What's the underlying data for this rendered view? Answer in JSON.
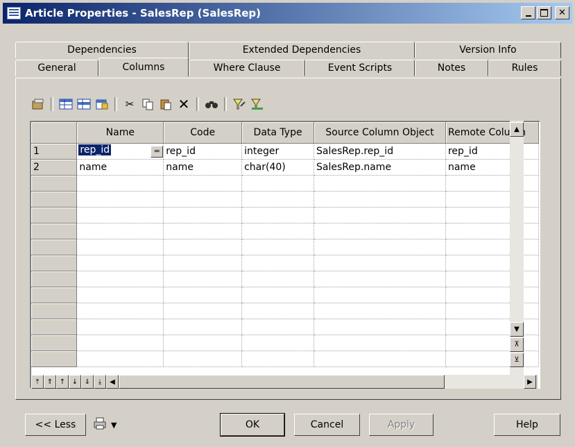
{
  "window": {
    "title": "Article Properties - SalesRep (SalesRep)"
  },
  "tabs_back": [
    "Dependencies",
    "Extended Dependencies",
    "Version Info"
  ],
  "tabs_front": [
    "General",
    "Columns",
    "Where Clause",
    "Event Scripts",
    "Notes",
    "Rules"
  ],
  "active_tab": "Columns",
  "toolbar": {
    "icons": [
      "properties-icon",
      "add-row-icon",
      "insert-row-icon",
      "add-columns-icon",
      "cut-icon",
      "copy-icon",
      "paste-icon",
      "delete-icon",
      "find-icon",
      "filter-icon",
      "clear-filter-icon"
    ]
  },
  "grid": {
    "columns": [
      "Name",
      "Code",
      "Data Type",
      "Source Column Object",
      "Remote Column"
    ],
    "rows": [
      {
        "num": "1",
        "name": "rep_id",
        "code": "rep_id",
        "type": "integer",
        "source": "SalesRep.rep_id",
        "remote": "rep_id"
      },
      {
        "num": "2",
        "name": "name",
        "code": "name",
        "type": "char(40)",
        "source": "SalesRep.name",
        "remote": "name"
      }
    ],
    "ellipsis": "="
  },
  "buttons": {
    "less": "<< Less",
    "ok": "OK",
    "cancel": "Cancel",
    "apply": "Apply",
    "help": "Help"
  }
}
